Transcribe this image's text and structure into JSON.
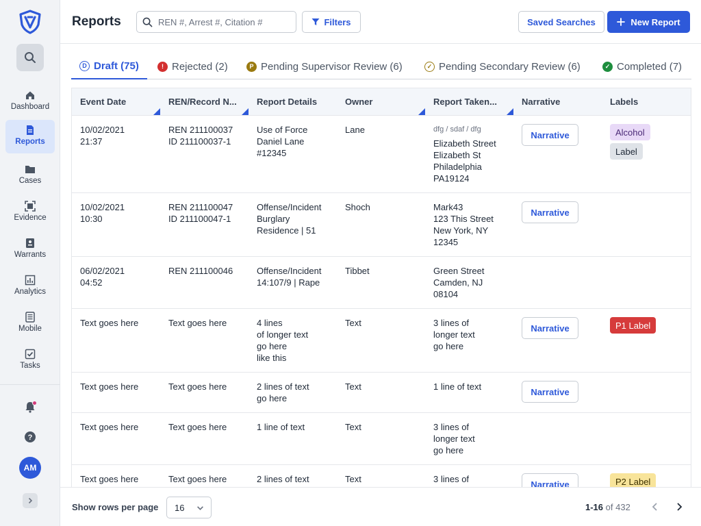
{
  "header": {
    "title": "Reports",
    "search_placeholder": "REN #, Arrest #, Citation #",
    "filters_label": "Filters",
    "saved_searches_label": "Saved Searches",
    "new_report_label": "New Report"
  },
  "sidebar": {
    "items": [
      {
        "label": "Dashboard",
        "icon": "home-icon"
      },
      {
        "label": "Reports",
        "icon": "document-icon"
      },
      {
        "label": "Cases",
        "icon": "folder-icon"
      },
      {
        "label": "Evidence",
        "icon": "evidence-icon"
      },
      {
        "label": "Warrants",
        "icon": "warrant-icon"
      },
      {
        "label": "Analytics",
        "icon": "chart-icon"
      },
      {
        "label": "Mobile",
        "icon": "mobile-icon"
      },
      {
        "label": "Tasks",
        "icon": "checkbox-icon"
      }
    ],
    "avatar_initials": "AM"
  },
  "tabs": [
    {
      "label": "Draft (75)",
      "icon_letter": "D"
    },
    {
      "label": "Rejected (2)",
      "icon_letter": "!"
    },
    {
      "label": "Pending Supervisor Review (6)",
      "icon_letter": "P"
    },
    {
      "label": "Pending Secondary Review (6)",
      "icon_letter": "✓"
    },
    {
      "label": "Completed (7)",
      "icon_letter": "✓"
    }
  ],
  "table": {
    "columns": [
      "Event Date",
      "REN/Record N...",
      "Report Details",
      "Owner",
      "Report Taken...",
      "Narrative",
      "Labels"
    ],
    "narrative_label": "Narrative",
    "rows": [
      {
        "event_date": [
          "10/02/2021",
          "21:37"
        ],
        "ren": [
          "REN 211100037",
          "ID 211100037-1"
        ],
        "details": [
          "Use of Force",
          "Daniel Lane",
          "#12345"
        ],
        "owner": "Lane",
        "taken_sub": "dfg / sdaf / dfg",
        "taken": [
          "Elizabeth Street",
          "Elizabeth St",
          "Philadelphia",
          "PA19124"
        ],
        "labels": [
          {
            "text": "Alcohol",
            "style": "alcohol"
          },
          {
            "text": "Label",
            "style": "gray"
          }
        ]
      },
      {
        "event_date": [
          "10/02/2021",
          "10:30"
        ],
        "ren": [
          "REN 211100047",
          "ID 211100047-1"
        ],
        "details": [
          "Offense/Incident",
          "Burglary",
          "Residence | 51"
        ],
        "owner": "Shoch",
        "taken": [
          "Mark43",
          "123 This Street",
          "New York, NY",
          "12345"
        ],
        "labels": []
      },
      {
        "event_date": [
          "06/02/2021",
          "04:52"
        ],
        "ren": [
          "REN 211100046"
        ],
        "details": [
          "Offense/Incident",
          "14:107/9 | Rape"
        ],
        "owner": "Tibbet",
        "taken": [
          "Green Street",
          "Camden, NJ",
          "08104"
        ],
        "labels": []
      },
      {
        "event_date": [
          "Text goes here"
        ],
        "ren": [
          "Text goes here"
        ],
        "details": [
          "4 lines",
          "of longer text",
          "go here",
          "like this"
        ],
        "owner": "Text",
        "taken": [
          "3 lines of",
          "longer text",
          "go here"
        ],
        "labels": [
          {
            "text": "P1 Label",
            "style": "red"
          }
        ]
      },
      {
        "event_date": [
          "Text goes here"
        ],
        "ren": [
          "Text goes here"
        ],
        "details": [
          "2 lines of text",
          "go here"
        ],
        "owner": "Text",
        "taken": [
          "1 line of text"
        ],
        "labels": []
      },
      {
        "event_date": [
          "Text goes here"
        ],
        "ren": [
          "Text goes here"
        ],
        "details": [
          "1 line of text"
        ],
        "owner": "Text",
        "taken": [
          "3 lines of",
          "longer text",
          "go here"
        ],
        "labels": []
      },
      {
        "event_date": [
          "Text goes here"
        ],
        "ren": [
          "Text goes here"
        ],
        "details": [
          "2 lines of text"
        ],
        "owner": "Text",
        "taken": [
          "3 lines of"
        ],
        "labels": [
          {
            "text": "P2 Label",
            "style": "yellow"
          }
        ]
      }
    ]
  },
  "footer": {
    "rows_per_page_label": "Show rows per page",
    "rows_per_page_value": "16",
    "range": "1-16",
    "of_total": "of 432"
  },
  "colors": {
    "accent": "#2e59d9",
    "rejected": "#d32f2f",
    "pending_supervisor": "#9a7a10",
    "completed": "#1e8e3e"
  }
}
